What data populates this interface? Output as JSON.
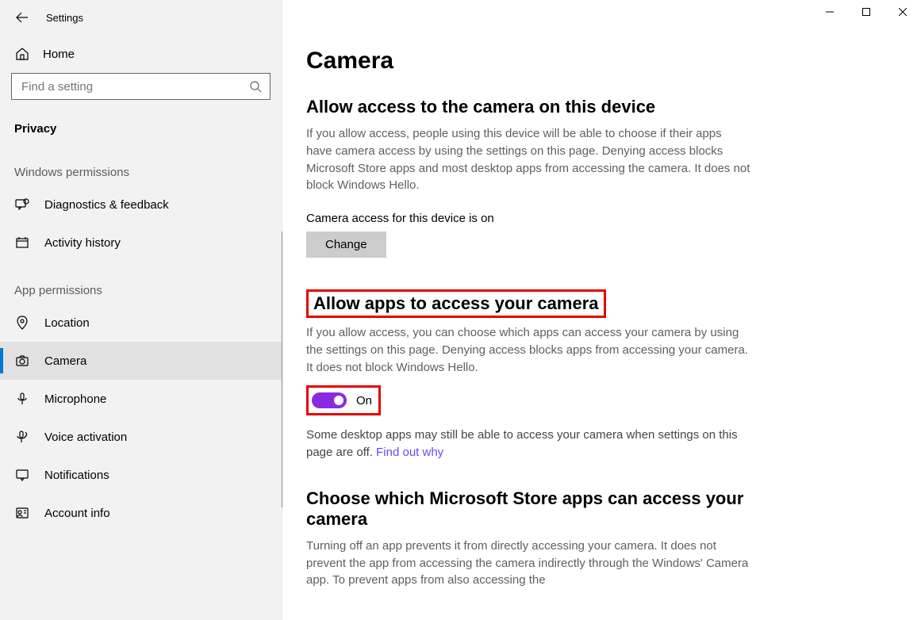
{
  "window": {
    "title": "Settings"
  },
  "sidebar": {
    "home": "Home",
    "search_placeholder": "Find a setting",
    "category": "Privacy",
    "groups": [
      {
        "label": "Windows permissions",
        "items": [
          {
            "id": "diagnostics",
            "label": "Diagnostics & feedback"
          },
          {
            "id": "activity",
            "label": "Activity history"
          }
        ]
      },
      {
        "label": "App permissions",
        "items": [
          {
            "id": "location",
            "label": "Location"
          },
          {
            "id": "camera",
            "label": "Camera",
            "selected": true
          },
          {
            "id": "microphone",
            "label": "Microphone"
          },
          {
            "id": "voice",
            "label": "Voice activation"
          },
          {
            "id": "notifications",
            "label": "Notifications"
          },
          {
            "id": "account",
            "label": "Account info"
          }
        ]
      }
    ]
  },
  "main": {
    "title": "Camera",
    "s1": {
      "heading": "Allow access to the camera on this device",
      "desc": "If you allow access, people using this device will be able to choose if their apps have camera access by using the settings on this page. Denying access blocks Microsoft Store apps and most desktop apps from accessing the camera. It does not block Windows Hello.",
      "status": "Camera access for this device is on",
      "change": "Change"
    },
    "s2": {
      "heading": "Allow apps to access your camera",
      "desc": "If you allow access, you can choose which apps can access your camera by using the settings on this page. Denying access blocks apps from accessing your camera. It does not block Windows Hello.",
      "toggle_state": "On",
      "note_text": "Some desktop apps may still be able to access your camera when settings on this page are off. ",
      "note_link": "Find out why"
    },
    "s3": {
      "heading": "Choose which Microsoft Store apps can access your camera",
      "desc": "Turning off an app prevents it from directly accessing your camera. It does not prevent the app from accessing the camera indirectly through the Windows' Camera app. To prevent apps from also accessing the"
    }
  },
  "highlights": {
    "section2_heading": true,
    "section2_toggle": true
  }
}
